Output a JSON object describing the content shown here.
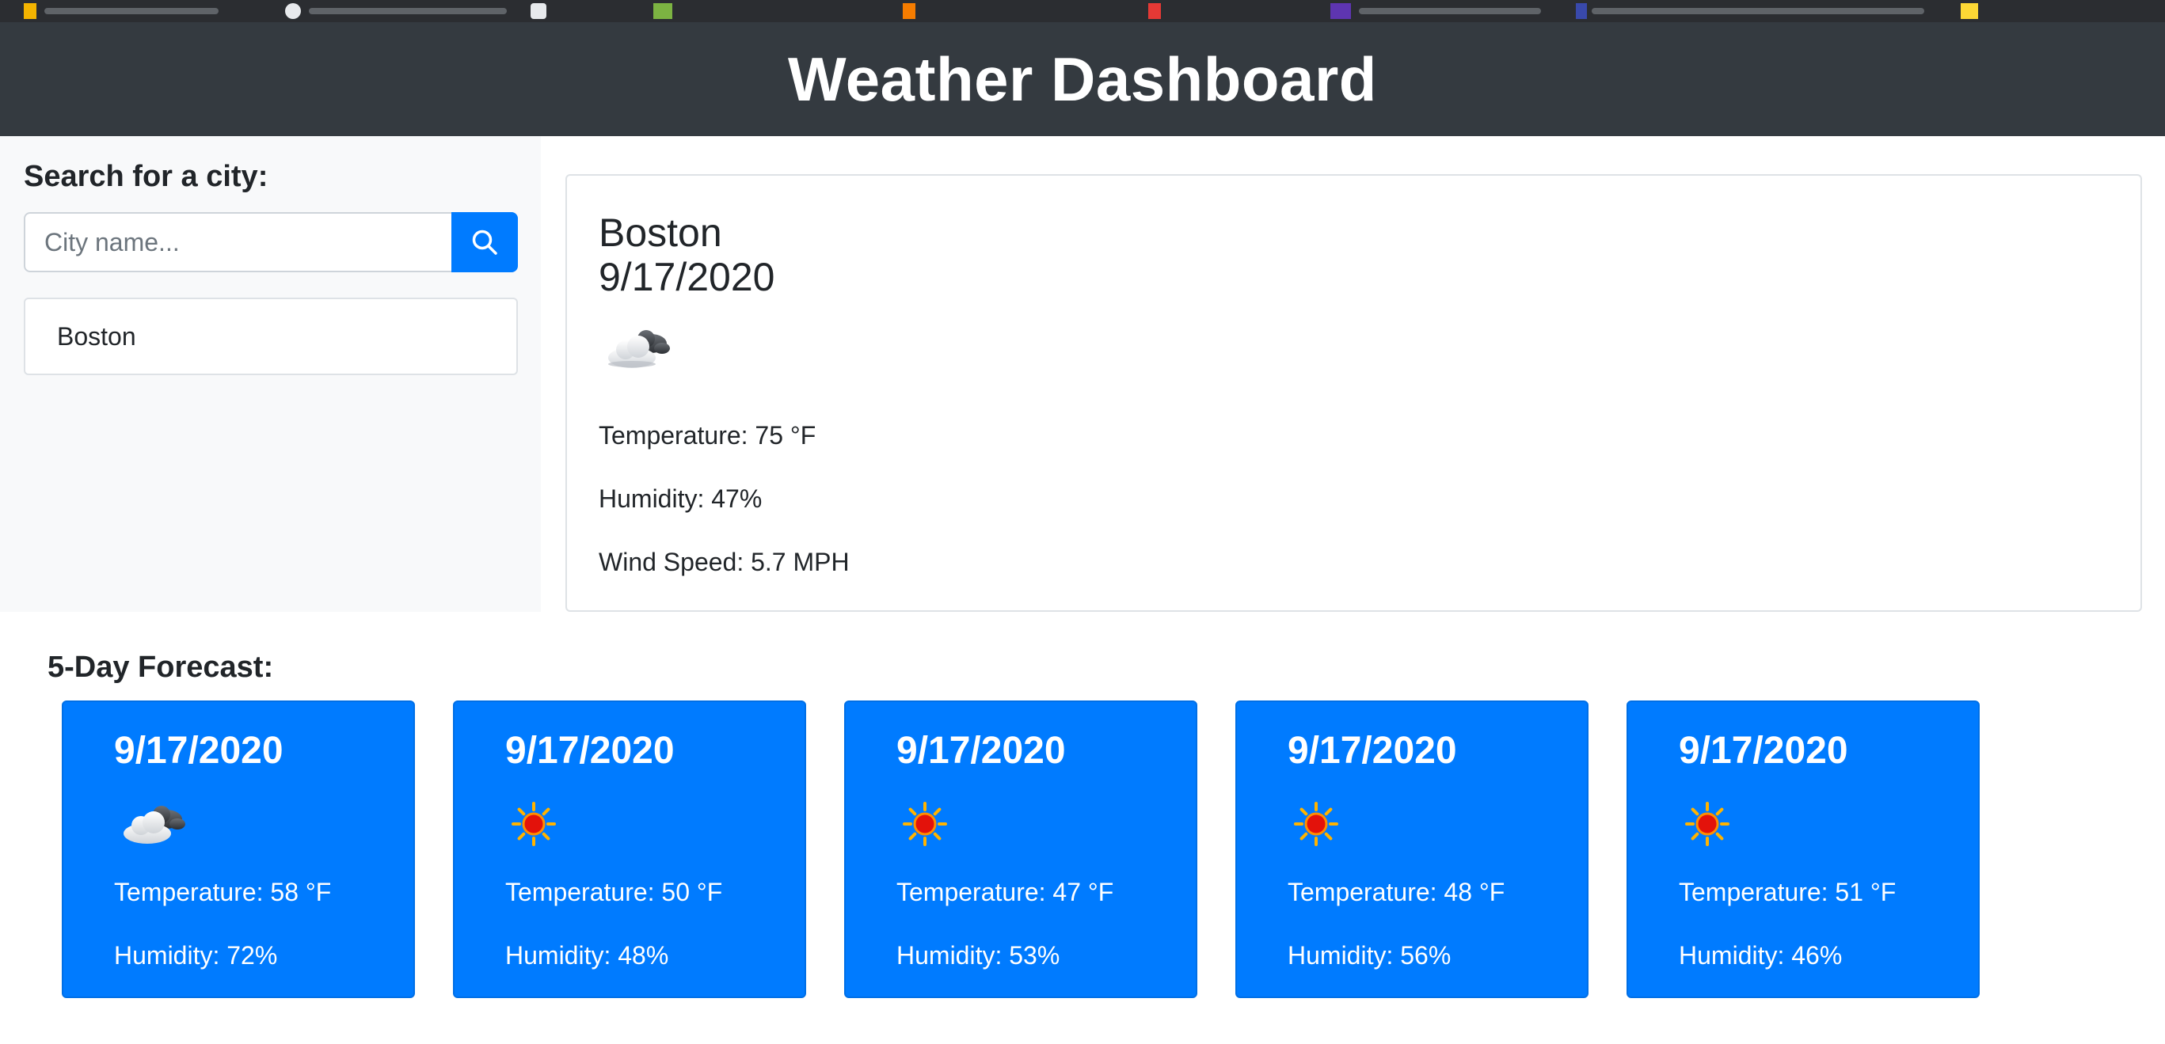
{
  "header": {
    "title": "Weather Dashboard"
  },
  "search": {
    "heading": "Search for a city:",
    "placeholder": "City name...",
    "button_icon": "search-icon"
  },
  "history": [
    {
      "label": "Boston"
    }
  ],
  "current": {
    "city": "Boston",
    "date": "9/17/2020",
    "icon": "partly-cloudy-icon",
    "temperature": "Temperature: 75 °F",
    "humidity": "Humidity: 47%",
    "wind": "Wind Speed: 5.7 MPH"
  },
  "forecast": {
    "heading": "5-Day Forecast:",
    "days": [
      {
        "date": "9/17/2020",
        "icon": "partly-cloudy-icon",
        "temperature": "Temperature: 58 °F",
        "humidity": "Humidity: 72%"
      },
      {
        "date": "9/17/2020",
        "icon": "sun-icon",
        "temperature": "Temperature: 50 °F",
        "humidity": "Humidity: 48%"
      },
      {
        "date": "9/17/2020",
        "icon": "sun-icon",
        "temperature": "Temperature: 47 °F",
        "humidity": "Humidity: 53%"
      },
      {
        "date": "9/17/2020",
        "icon": "sun-icon",
        "temperature": "Temperature: 48 °F",
        "humidity": "Humidity: 56%"
      },
      {
        "date": "9/17/2020",
        "icon": "sun-icon",
        "temperature": "Temperature: 51 °F",
        "humidity": "Humidity: 46%"
      }
    ]
  },
  "colors": {
    "header_bg": "#343a40",
    "primary": "#007bff",
    "sidebar_bg": "#f8f9fa"
  }
}
